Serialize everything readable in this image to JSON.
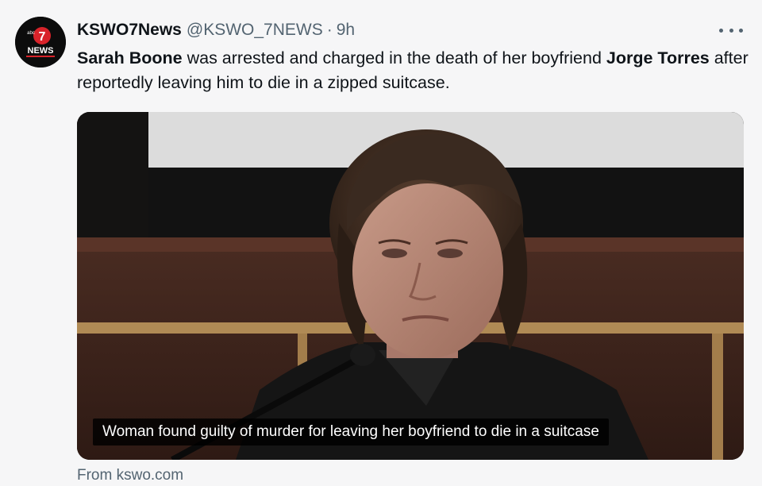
{
  "tweet": {
    "avatar_label": "NEWS",
    "avatar_number": "7",
    "display_name": "KSWO7News",
    "handle": "@KSWO_7NEWS",
    "separator": "·",
    "time": "9h",
    "more_icon": "more-horizontal-icon",
    "text": {
      "person1": "Sarah Boone",
      "part1": " was arrested and charged in the death of her boyfriend ",
      "person2": "Jorge Torres",
      "part2": " after reportedly leaving him to die in a zipped suitcase."
    },
    "media": {
      "caption": "Woman found guilty of murder for leaving her boyfriend to die in a suitcase"
    },
    "source": "From kswo.com"
  },
  "colors": {
    "background": "#f6f6f7",
    "text_primary": "#0f1419",
    "text_secondary": "#536471",
    "caption_bg": "#000000",
    "caption_text": "#ffffff"
  }
}
